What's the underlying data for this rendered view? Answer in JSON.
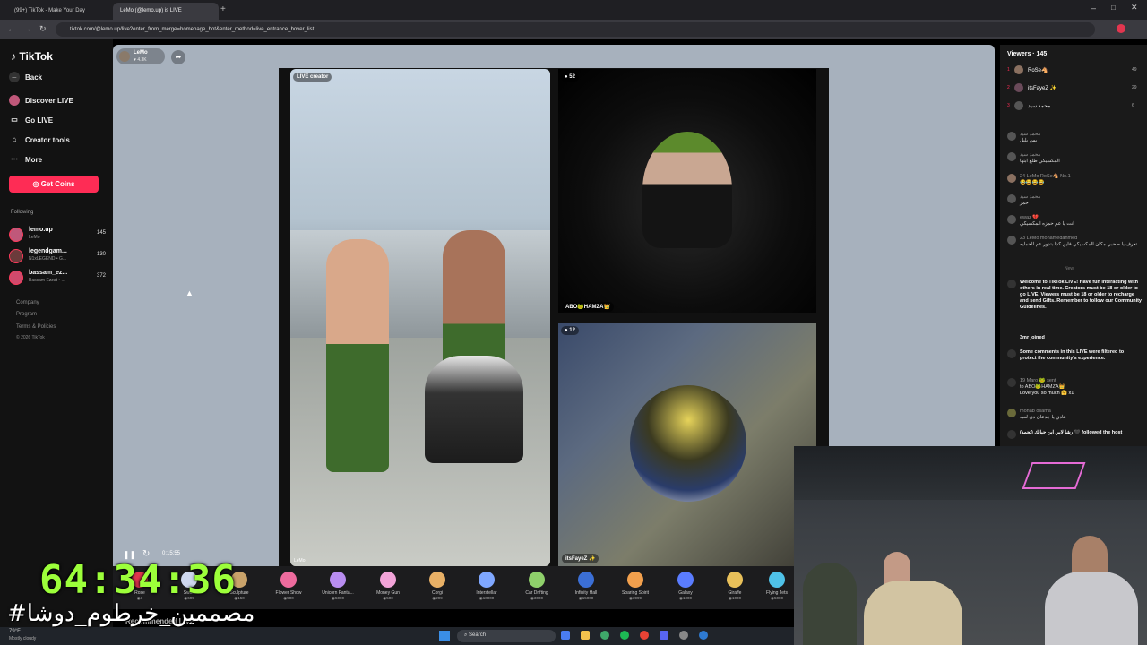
{
  "browser": {
    "tabs": [
      {
        "label": "(99+) TikTok - Make Your Day"
      },
      {
        "label": "LeMo (@lemo.up) is LIVE"
      }
    ],
    "url": "tiktok.com/@lemo.up/live?enter_from_merge=homepage_hot&enter_method=live_entrance_hover_list"
  },
  "sidebar": {
    "logo": "TikTok",
    "back": "Back",
    "nav": [
      "Discover LIVE",
      "Go LIVE",
      "Creator tools",
      "More"
    ],
    "get_coins": "Get Coins",
    "following_label": "Following",
    "following": [
      {
        "name": "lemo.up",
        "sub": "LeMo",
        "count": "145"
      },
      {
        "name": "legendgam...",
        "sub": "N1xLEGEND • G...",
        "count": "130"
      },
      {
        "name": "bassam_ez...",
        "sub": "Bassam Ezzat • ...",
        "count": "372"
      }
    ],
    "footer": [
      "Company",
      "Program",
      "Terms & Policies",
      "© 2026 TikTok"
    ]
  },
  "stream": {
    "host_name": "LeMo",
    "host_likes": "4.3K",
    "main_badge": "LIVE creator",
    "main_name": "LeMo",
    "panel_a_count": "52",
    "panel_a_name": "ABO🐸HAMZA👑",
    "panel_b_count": "12",
    "panel_b_name": "itsFayeZ ✨",
    "elapsed": "0:15:55"
  },
  "gifts": [
    {
      "name": "Rose",
      "price": "1",
      "color": "#e2364f"
    },
    {
      "name": "Swan",
      "price": "699",
      "color": "#cfd8ef"
    },
    {
      "name": "Sculpture",
      "price": "150",
      "color": "#c9a26a"
    },
    {
      "name": "Flower Show",
      "price": "500",
      "color": "#ee6b9e"
    },
    {
      "name": "Unicorn Fanta...",
      "price": "5000",
      "color": "#b88df0"
    },
    {
      "name": "Money Gun",
      "price": "500",
      "color": "#f2a3d8"
    },
    {
      "name": "Corgi",
      "price": "299",
      "color": "#e8b066"
    },
    {
      "name": "Interstellar",
      "price": "10000",
      "color": "#7fa7ff"
    },
    {
      "name": "Car Drifting",
      "price": "3000",
      "color": "#8fd06b"
    },
    {
      "name": "Infinity Hall",
      "price": "15000",
      "color": "#3b6fd6"
    },
    {
      "name": "Soaring Spirit",
      "price": "3999",
      "color": "#f2a04d"
    },
    {
      "name": "Galaxy",
      "price": "1000",
      "color": "#5a7cff"
    },
    {
      "name": "Giraffe",
      "price": "1000",
      "color": "#e8c05a"
    },
    {
      "name": "Flying Jets",
      "price": "5000",
      "color": "#4fc2e8"
    }
  ],
  "recommended_label": "Recommended LIVE",
  "chat": {
    "viewers_label": "Viewers · 145",
    "top_viewers": [
      {
        "rank": "1",
        "name": "RoSe🐴",
        "score": "49"
      },
      {
        "rank": "2",
        "name": "itsFayeZ ✨",
        "score": "29"
      },
      {
        "rank": "3",
        "name": "محمد سيد",
        "score": "6"
      }
    ],
    "messages": [
      {
        "user": "محمد سيد",
        "text": "بس يلبل"
      },
      {
        "user": "محمد سيد",
        "text": "المكسيكي طلع ابنها"
      },
      {
        "user": "24 LeMo RoSe🐴 No.1",
        "text": "😂😂😂😂"
      },
      {
        "user": "محمد سيد",
        "text": "حمر"
      },
      {
        "user": "ewaz 💔",
        "text": "انت يا عم حمزه المكسيكي"
      },
      {
        "user": "23 LeMo mohamedahmed",
        "text": "تعرف يا صحبي مكان المكسيكي فاين كدا بتدور عم الحمايه"
      }
    ],
    "new_label": "New",
    "welcome": "Welcome to TikTok LIVE! Have fun interacting with others in real time. Creators must be 18 or older to go LIVE. Viewers must be 18 or older to recharge and send Gifts. Remember to follow our Community Guidelines.",
    "joined": "3mr joined",
    "filtered": "Some comments in this LIVE were filtered to protect the community's experience.",
    "gift_user": "19 Maro 🐸 sent",
    "gift_to": "to ABO🐸HAMZA👑",
    "gift_text": "Love you so much 🤗 x1",
    "last_user": "mohab osama",
    "last_text": "عادي يا جدعان دي لعبه",
    "followed": "رشا لابي ابن حبابك (تحمد) 🖤 followed the host"
  },
  "overlay": {
    "timer": "64:34:36",
    "hashtag": "#مصممين_خرطوم_دوشا"
  },
  "taskbar": {
    "weather_temp": "79°F",
    "weather_text": "Mostly cloudy",
    "search": "Search"
  },
  "colors": {
    "accent": "#fe2c55",
    "timer": "#9cff3a"
  }
}
